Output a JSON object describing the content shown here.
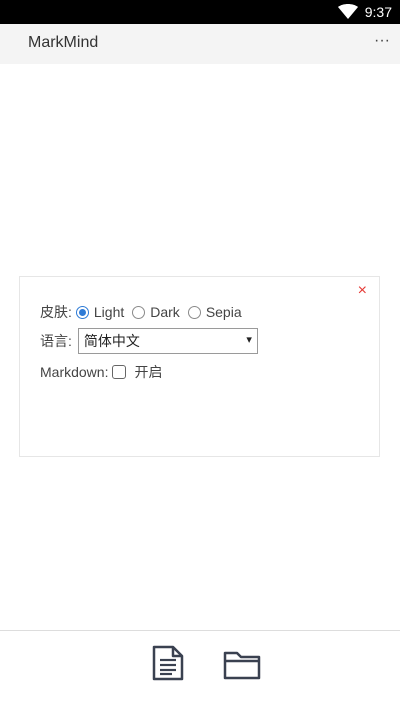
{
  "status_bar": {
    "time": "9:37"
  },
  "app_bar": {
    "title": "MarkMind",
    "more": "···"
  },
  "settings_panel": {
    "close": "×",
    "skin": {
      "label": "皮肤:",
      "options": [
        "Light",
        "Dark",
        "Sepia"
      ],
      "selected": "Light"
    },
    "language": {
      "label": "语言:",
      "value": "简体中文",
      "caret": "▾"
    },
    "markdown": {
      "label": "Markdown:",
      "toggle_label": "开启",
      "checked": false
    }
  },
  "bottom_bar": {
    "icons": [
      "document-icon",
      "folder-icon"
    ]
  },
  "colors": {
    "accent": "#2e7bd6",
    "close": "#e53935",
    "appbar_bg": "#f4f4f4"
  }
}
